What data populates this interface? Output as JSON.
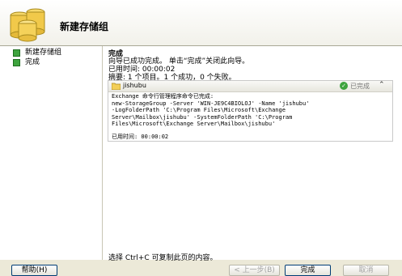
{
  "header": {
    "title": "新建存储组",
    "icon": "database-icon"
  },
  "steps": [
    {
      "label": "新建存储组",
      "status_color": "#3ea43e"
    },
    {
      "label": "完成",
      "status_color": "#3ea43e"
    }
  ],
  "main": {
    "heading": "完成",
    "message": "向导已成功完成。 单击“完成”关闭此向导。",
    "elapsed": "已用时间:  00:00:02",
    "summary": "摘要: 1 个项目。1 个成功，0 个失败。",
    "task": {
      "name": "jishubu",
      "status": "已完成",
      "status_color": "#3ea43e",
      "lines": [
        "Exchange 命令行管理程序命令已完成:",
        "new-StorageGroup -Server 'WIN-JE9C4BIOLOJ' -Name 'jishubu'",
        "-LogFolderPath 'C:\\Program Files\\Microsoft\\Exchange",
        "Server\\Mailbox\\jishubu' -SystemFolderPath 'C:\\Program",
        "Files\\Microsoft\\Exchange Server\\Mailbox\\jishubu'"
      ],
      "elapsed": "已用时间:  00:00:02"
    }
  },
  "hint": "选择 Ctrl+C 可复制此页的内容。",
  "buttons": {
    "help": "帮助(H)",
    "back": "< 上一步(B)",
    "finish": "完成",
    "cancel": "取消"
  }
}
